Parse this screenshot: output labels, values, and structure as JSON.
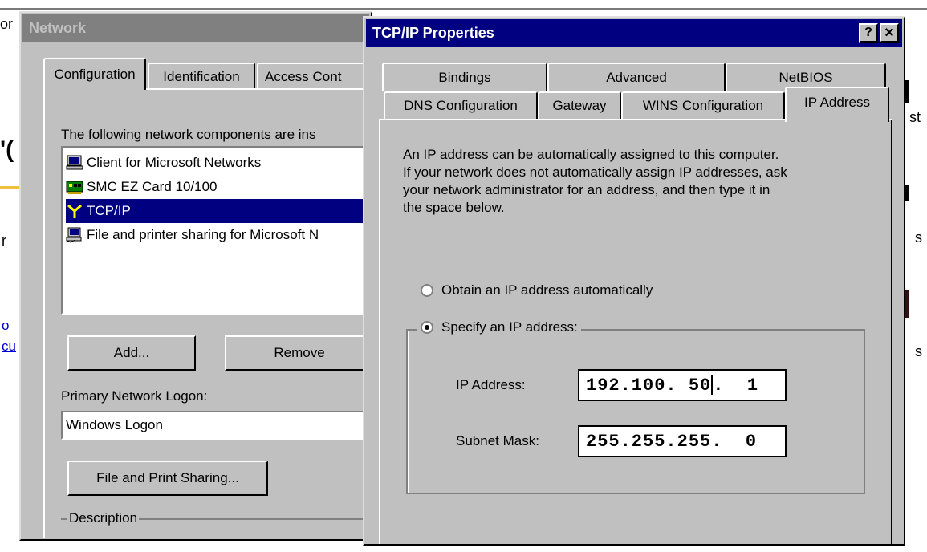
{
  "background": {
    "fragments": [
      "or",
      "st",
      "s",
      "s",
      "r"
    ],
    "links": [
      "o",
      "cu"
    ]
  },
  "network_window": {
    "title": "Network",
    "tabs": [
      "Configuration",
      "Identification",
      "Access Cont"
    ],
    "components_label": "The following network components are ins",
    "components": [
      {
        "icon": "client-icon",
        "label": "Client for Microsoft Networks",
        "selected": false
      },
      {
        "icon": "network-card-icon",
        "label": "SMC EZ Card 10/100",
        "selected": false
      },
      {
        "icon": "protocol-icon",
        "label": "TCP/IP",
        "selected": true
      },
      {
        "icon": "file-sharing-icon",
        "label": "File and printer sharing for Microsoft N",
        "selected": false
      }
    ],
    "add_label": "Add...",
    "remove_label": "Remove",
    "primary_logon_label": "Primary Network Logon:",
    "primary_logon_value": "Windows Logon",
    "file_print_label": "File and Print Sharing...",
    "description_label": "Description"
  },
  "tcpip_window": {
    "title": "TCP/IP Properties",
    "help_label": "?",
    "close_label": "×",
    "tabs_row1": [
      "Bindings",
      "Advanced",
      "NetBIOS"
    ],
    "tabs_row2": [
      "DNS Configuration",
      "Gateway",
      "WINS Configuration",
      "IP Address"
    ],
    "active_tab": "IP Address",
    "intro_lines": [
      "An IP address can be automatically assigned to this computer.",
      "If your network does not automatically assign IP addresses, ask",
      "your network administrator for an address, and then type it in",
      "the space below."
    ],
    "option_auto": "Obtain an IP address automatically",
    "option_specify": "Specify an IP address:",
    "selected_option": "specify",
    "ip_label": "IP Address:",
    "ip_value_before_caret": "192.100. 50",
    "ip_value_after_caret": ".  1",
    "subnet_label": "Subnet Mask:",
    "subnet_value": "255.255.255.  0"
  }
}
